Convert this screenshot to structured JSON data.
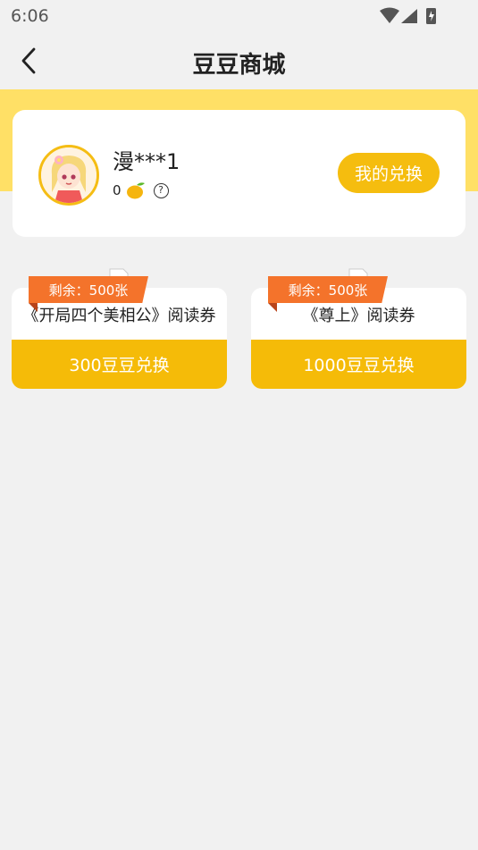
{
  "status_bar": {
    "time": "6:06"
  },
  "nav": {
    "title": "豆豆商城"
  },
  "user": {
    "name": "漫***1",
    "beans": "0",
    "help_icon": "?",
    "exchange_label": "我的兑换"
  },
  "products": [
    {
      "ribbon": "剩余：500张",
      "title": "《开局四个美相公》阅读券",
      "button": "300豆豆兑换"
    },
    {
      "ribbon": "剩余：500张",
      "title": "《尊上》阅读券",
      "button": "1000豆豆兑换"
    }
  ],
  "colors": {
    "accent": "#f5bd0f",
    "band": "#ffe066",
    "ribbon": "#f4732b"
  }
}
